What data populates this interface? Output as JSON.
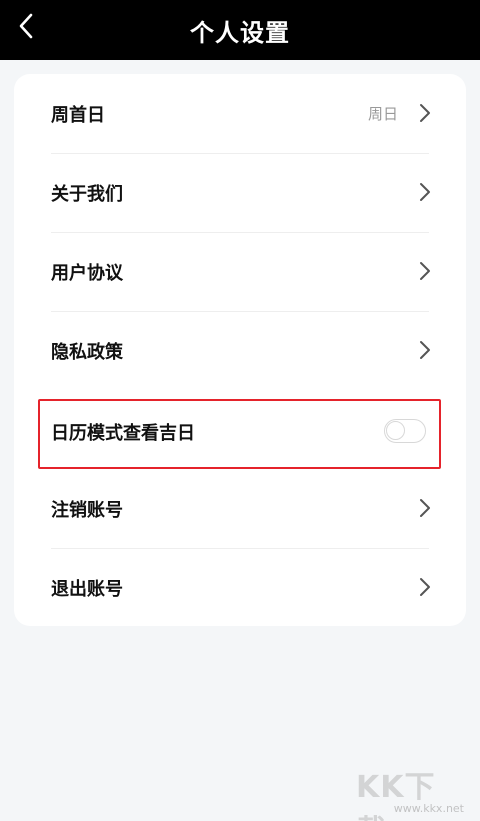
{
  "header": {
    "title": "个人设置",
    "back_icon": "chevron-left-icon"
  },
  "settings": {
    "week_start": {
      "label": "周首日",
      "value": "周日"
    },
    "about": {
      "label": "关于我们"
    },
    "user_agreement": {
      "label": "用户协议"
    },
    "privacy_policy": {
      "label": "隐私政策"
    },
    "calendar_lucky": {
      "label": "日历模式查看吉日",
      "toggle_on": false
    },
    "cancel_account": {
      "label": "注销账号"
    },
    "logout": {
      "label": "退出账号"
    }
  },
  "watermark": {
    "logo": "KK下载",
    "url": "www.kkx.net"
  },
  "colors": {
    "header_bg": "#000000",
    "page_bg": "#f4f6f8",
    "highlight": "#e5232b"
  }
}
